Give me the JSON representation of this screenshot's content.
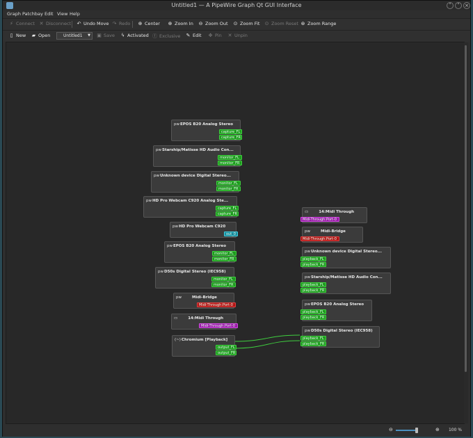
{
  "window": {
    "title": "Untitled1 — A PipeWire Graph Qt GUI Interface"
  },
  "menu": [
    "Graph",
    "Patchbay",
    "Edit",
    "View",
    "Help"
  ],
  "toolbar1": {
    "connect": "Connect",
    "disconnect": "Disconnect",
    "undo_move": "Undo Move",
    "redo": "Redo",
    "center": "Center",
    "zoom_in": "Zoom In",
    "zoom_out": "Zoom Out",
    "zoom_fit": "Zoom Fit",
    "zoom_reset": "Zoom Reset",
    "zoom_range": "Zoom Range"
  },
  "toolbar2": {
    "new": "New",
    "open": "Open",
    "patchbay": "Untitled1",
    "save": "Save",
    "activated": "Activated",
    "exclusive": "Exclusive",
    "edit": "Edit",
    "pin": "Pin",
    "unpin": "Unpin"
  },
  "status": {
    "zoom": "100 %"
  },
  "nodes": {
    "epos_capture": {
      "title": "EPOS B20 Analog Stereo",
      "ports": [
        "capture_FL",
        "capture_FR"
      ]
    },
    "starship_monitor": {
      "title": "Starship/Matisse HD Audio Con...",
      "ports": [
        "monitor_FL",
        "monitor_FR"
      ]
    },
    "unknown_monitor": {
      "title": "Unknown device Digital Stereo...",
      "ports": [
        "monitor_FL",
        "monitor_FR"
      ]
    },
    "webcam_capture": {
      "title": "HD Pro Webcam C920 Analog Ste...",
      "ports": [
        "capture_FL",
        "capture_FR"
      ]
    },
    "webcam_video": {
      "title": "HD Pro Webcam C920",
      "ports": [
        "out_0"
      ]
    },
    "epos_monitor": {
      "title": "EPOS B20 Analog Stereo",
      "ports": [
        "monitor_FL",
        "monitor_FR"
      ]
    },
    "d50s_monitor": {
      "title": "D50s Digital Stereo (IEC958)",
      "ports": [
        "monitor_FL",
        "monitor_FR"
      ]
    },
    "midi_bridge_out": {
      "title": "Midi-Bridge",
      "ports": [
        "Midi-Through:Port-0"
      ]
    },
    "midi_through_out": {
      "title": "14:Midi Through",
      "ports": [
        "Midi-Through:Port-0"
      ]
    },
    "chromium": {
      "title": "Chromium [Playback]",
      "ports": [
        "output_FL",
        "output_FR"
      ]
    },
    "midi_through_in": {
      "title": "14:Midi Through",
      "ports": [
        "Midi-Through:Port-0"
      ]
    },
    "midi_bridge_in": {
      "title": "Midi-Bridge",
      "ports": [
        "Midi-Through:Port-0"
      ]
    },
    "unknown_playback": {
      "title": "Unknown device Digital Stereo...",
      "ports": [
        "playback_FL",
        "playback_FR"
      ]
    },
    "starship_playback": {
      "title": "Starship/Matisse HD Audio Con...",
      "ports": [
        "playback_FL",
        "playback_FR"
      ]
    },
    "epos_playback": {
      "title": "EPOS B20 Analog Stereo",
      "ports": [
        "playback_FL",
        "playback_FR"
      ]
    },
    "d50s_playback": {
      "title": "D50s Digital Stereo (IEC958)",
      "ports": [
        "playback_FL",
        "playback_FR"
      ]
    }
  },
  "node_icons": {
    "pipewire": "pw",
    "midi": "▭",
    "chromium": "(~)"
  },
  "colors": {
    "audio": "#1f9a1f",
    "video": "#1a8a9a",
    "midi": "#9a1aa8",
    "bridge": "#b01414",
    "wire": "#3fd03f"
  }
}
